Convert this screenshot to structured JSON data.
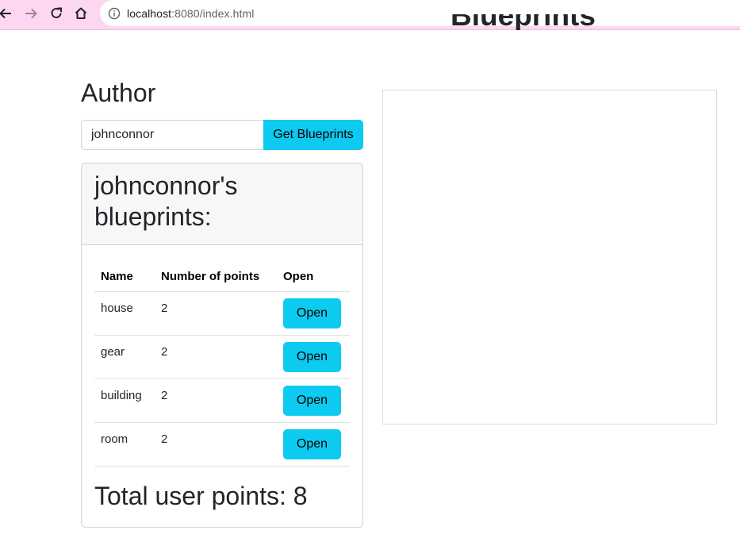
{
  "browser": {
    "url_host": "localhost",
    "url_path": ":8080/index.html",
    "icons": [
      "back-icon",
      "forward-icon",
      "reload-icon",
      "home-icon",
      "info-icon"
    ]
  },
  "page": {
    "title": "Blueprints"
  },
  "author": {
    "heading": "Author",
    "input_value": "johnconnor",
    "button_label": "Get Blueprints"
  },
  "blueprints": {
    "header_line1": "johnconnor's",
    "header_line2": "blueprints:",
    "columns": [
      "Name",
      "Number of points",
      "Open"
    ],
    "rows": [
      {
        "name": "house",
        "points": "2",
        "action": "Open"
      },
      {
        "name": "gear",
        "points": "2",
        "action": "Open"
      },
      {
        "name": "building",
        "points": "2",
        "action": "Open"
      },
      {
        "name": "room",
        "points": "2",
        "action": "Open"
      }
    ],
    "total_label": "Total user points: 8"
  },
  "colors": {
    "accent": "#0dcaf0",
    "browser_bar": "#fdd7f1"
  }
}
